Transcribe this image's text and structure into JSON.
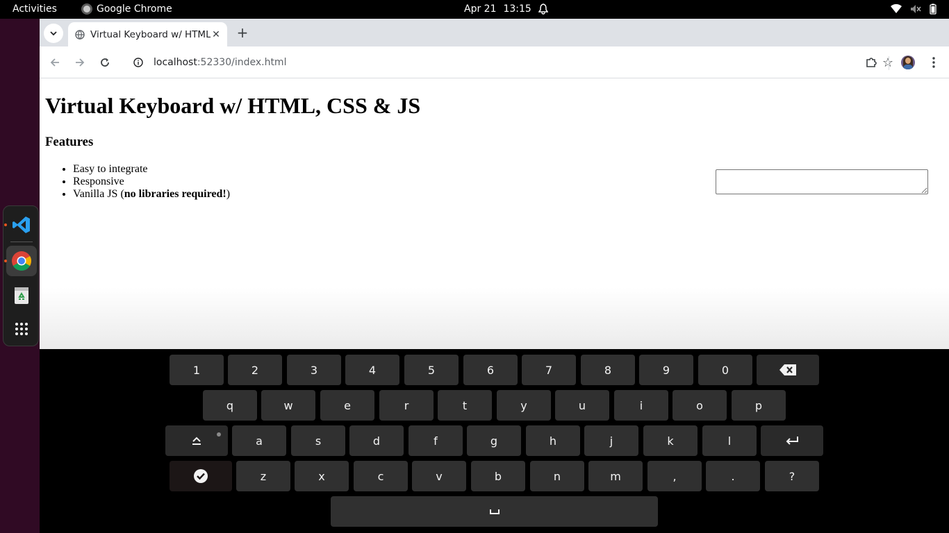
{
  "topbar": {
    "activities": "Activities",
    "app_name": "Google Chrome",
    "date": "Apr 21",
    "time": "13:15"
  },
  "dock": {
    "items": [
      "vscode-icon",
      "chrome-icon",
      "trash-icon",
      "app-grid-icon"
    ]
  },
  "browser": {
    "tab_title": "Virtual Keyboard w/ HTML, CSS & JS",
    "url_host": "localhost",
    "url_path": ":52330/index.html"
  },
  "page": {
    "heading": "Virtual Keyboard w/ HTML, CSS & JS",
    "features_heading": "Features",
    "features": [
      "Easy to integrate",
      "Responsive",
      "Vanilla JS ("
    ],
    "feature3_bold": "no libraries required!",
    "feature3_end": ")",
    "textarea_value": ""
  },
  "keyboard": {
    "row1": [
      "1",
      "2",
      "3",
      "4",
      "5",
      "6",
      "7",
      "8",
      "9",
      "0"
    ],
    "row2": [
      "q",
      "w",
      "e",
      "r",
      "t",
      "y",
      "u",
      "i",
      "o",
      "p"
    ],
    "row3": [
      "a",
      "s",
      "d",
      "f",
      "g",
      "h",
      "j",
      "k",
      "l"
    ],
    "row4": [
      "z",
      "x",
      "c",
      "v",
      "b",
      "n",
      "m",
      ",",
      ".",
      "?"
    ],
    "icons": {
      "backspace": "backspace-icon",
      "caps": "caps-lock-icon",
      "enter": "enter-icon",
      "done": "check-circle-icon",
      "space": "space-icon"
    }
  }
}
